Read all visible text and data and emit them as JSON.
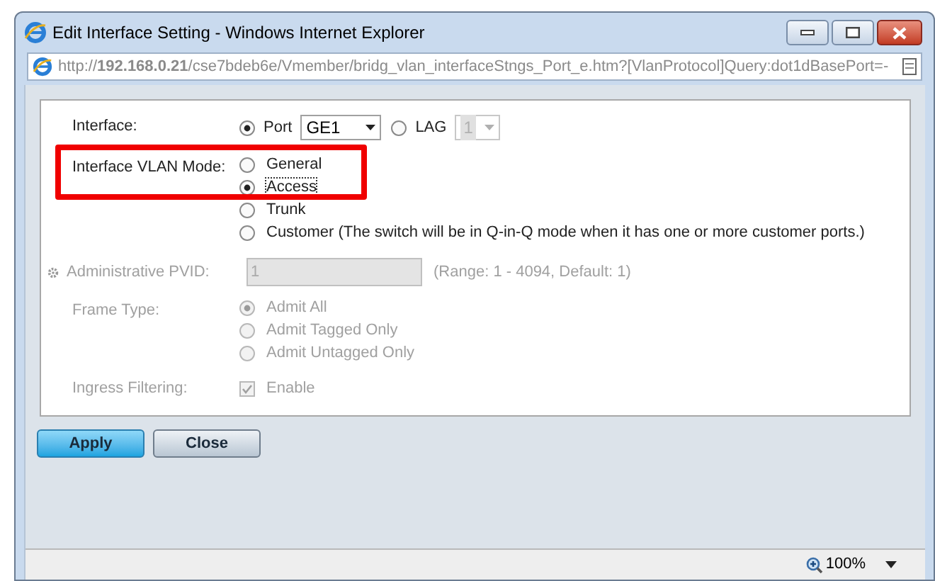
{
  "window": {
    "title": "Edit Interface Setting - Windows Internet Explorer"
  },
  "address_bar": {
    "url": "http://**192.168.0.21**/cse7bdeb6e/Vmember/bridg_vlan_interfaceStngs_Port_e.htm?[VlanProtocol]Query:dot1dBasePort=-"
  },
  "form": {
    "interface": {
      "label": "Interface:",
      "options": [
        {
          "label": "Port",
          "selected": true,
          "value": "GE1",
          "disabled": false
        },
        {
          "label": "LAG",
          "selected": false,
          "value": "1",
          "disabled": true
        }
      ]
    },
    "vlan_mode": {
      "label": "Interface VLAN Mode:",
      "highlighted": true,
      "options": [
        {
          "label": "General",
          "selected": false,
          "focused": false
        },
        {
          "label": "Access",
          "selected": true,
          "focused": true
        },
        {
          "label": "Trunk",
          "selected": false,
          "focused": false
        },
        {
          "label": "Customer (The switch will be in Q-in-Q mode when it has one or more customer ports.)",
          "selected": false,
          "focused": false
        }
      ]
    },
    "pvid": {
      "label": "Administrative PVID:",
      "value": "1",
      "hint": "(Range: 1 - 4094, Default: 1)",
      "disabled": true
    },
    "frame_type": {
      "label": "Frame Type:",
      "disabled": true,
      "options": [
        {
          "label": "Admit All",
          "selected": true
        },
        {
          "label": "Admit Tagged Only",
          "selected": false
        },
        {
          "label": "Admit Untagged Only",
          "selected": false
        }
      ]
    },
    "ingress": {
      "label": "Ingress Filtering:",
      "disabled": true,
      "checkbox": {
        "label": "Enable",
        "checked": true
      }
    }
  },
  "buttons": [
    {
      "label": "Apply",
      "kind": "primary"
    },
    {
      "label": "Close",
      "kind": "secondary"
    }
  ],
  "status_bar": {
    "zoom": "100%"
  }
}
